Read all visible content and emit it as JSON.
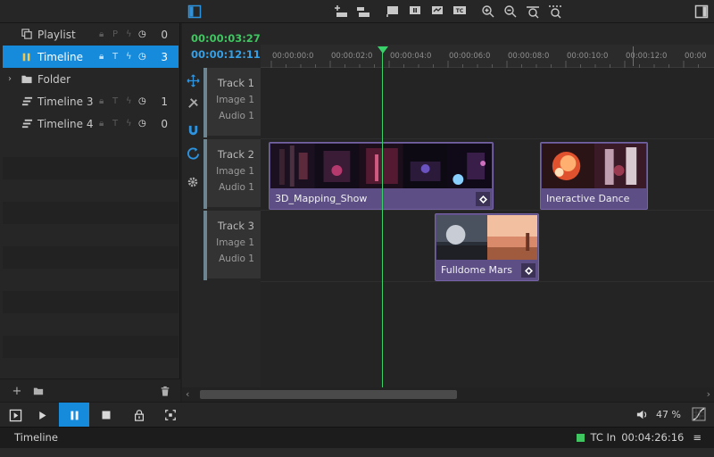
{
  "left_panel": {
    "items": [
      {
        "label": "Playlist",
        "flags": [
          "lock",
          "P",
          "bolt",
          "clock"
        ],
        "count": "0",
        "selected": false
      },
      {
        "label": "Timeline",
        "flags": [
          "lock",
          "T",
          "bolt",
          "clock"
        ],
        "count": "3",
        "selected": true
      },
      {
        "label": "Folder",
        "flags": [],
        "count": "",
        "selected": false
      },
      {
        "label": "Timeline 3",
        "flags": [
          "lock",
          "T",
          "bolt",
          "clock"
        ],
        "count": "1",
        "selected": false
      },
      {
        "label": "Timeline 4",
        "flags": [
          "lock",
          "T",
          "bolt",
          "clock"
        ],
        "count": "0",
        "selected": false
      }
    ]
  },
  "timecode": {
    "current": "00:00:03:27",
    "duration": "00:00:12:11"
  },
  "ruler": {
    "ticks": [
      "00:00:00:0",
      "00:00:02:0",
      "00:00:04:0",
      "00:00:06:0",
      "00:00:08:0",
      "00:00:10:0",
      "00:00:12:0",
      "00:00"
    ]
  },
  "tracks": [
    {
      "name": "Track 1",
      "image": "Image 1",
      "audio": "Audio 1"
    },
    {
      "name": "Track 2",
      "image": "Image 1",
      "audio": "Audio 1"
    },
    {
      "name": "Track 3",
      "image": "Image 1",
      "audio": "Audio 1"
    }
  ],
  "clips": {
    "mapping": "3D_Mapping_Show",
    "dance": "Ineractive Dance",
    "mars": "Fulldome Mars"
  },
  "transport": {
    "volume": "47 %"
  },
  "status": {
    "view": "Timeline",
    "tc_label": "TC In",
    "tc_value": "00:04:26:16"
  },
  "colors": {
    "accent": "#168bdc",
    "clip": "#5d4f86",
    "playhead": "#39d16a",
    "tc_current": "#3fc660",
    "tc_duration": "#35a0e6"
  }
}
